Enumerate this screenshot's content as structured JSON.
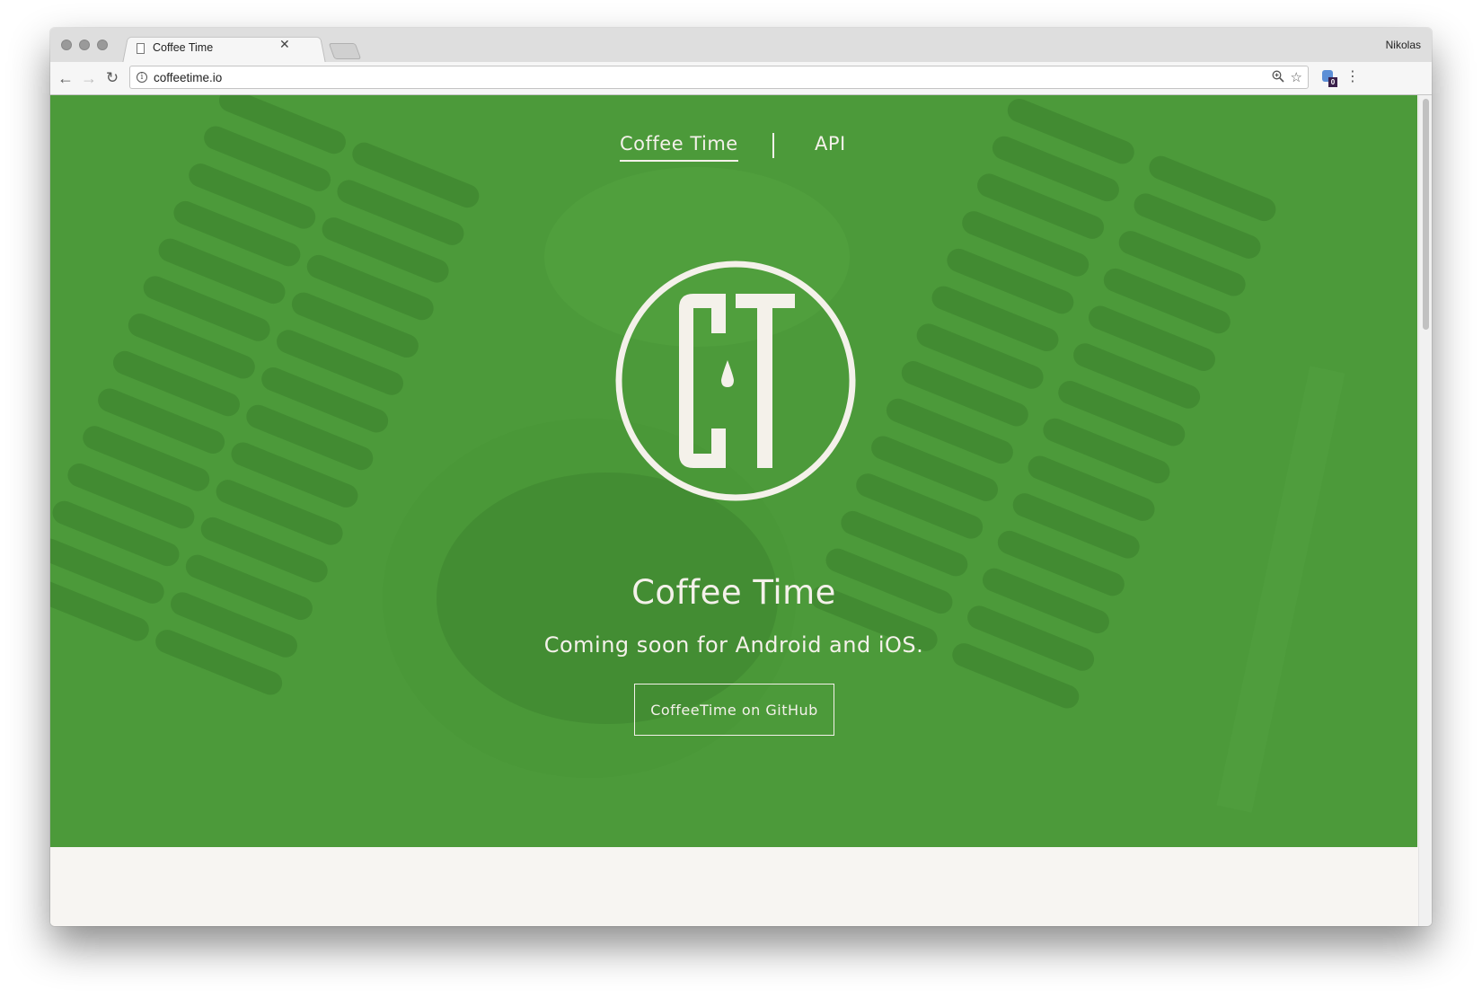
{
  "browser": {
    "tab_title": "Coffee Time",
    "profile_name": "Nikolas",
    "url": "coffeetime.io",
    "icons": {
      "back": "back-arrow-icon",
      "forward": "forward-arrow-icon",
      "reload": "reload-icon",
      "info": "info-icon",
      "zoom": "zoom-icon",
      "bookmark": "star-icon",
      "extension": "extension-icon",
      "menu": "menu-dots-icon"
    },
    "extension_badge": "0"
  },
  "page": {
    "nav": {
      "items": [
        {
          "label": "Coffee Time",
          "active": true
        },
        {
          "label": "API",
          "active": false
        }
      ]
    },
    "logo": {
      "name": "coffee-time-logo",
      "letters": "CT"
    },
    "hero": {
      "title": "Coffee Time",
      "subtitle": "Coming soon for Android and iOS.",
      "button_label": "CoffeeTime on GitHub"
    },
    "colors": {
      "hero_green": "#4c9a3a",
      "text_cream": "#f4f1ea",
      "lower_background": "#f7f5f2"
    }
  }
}
